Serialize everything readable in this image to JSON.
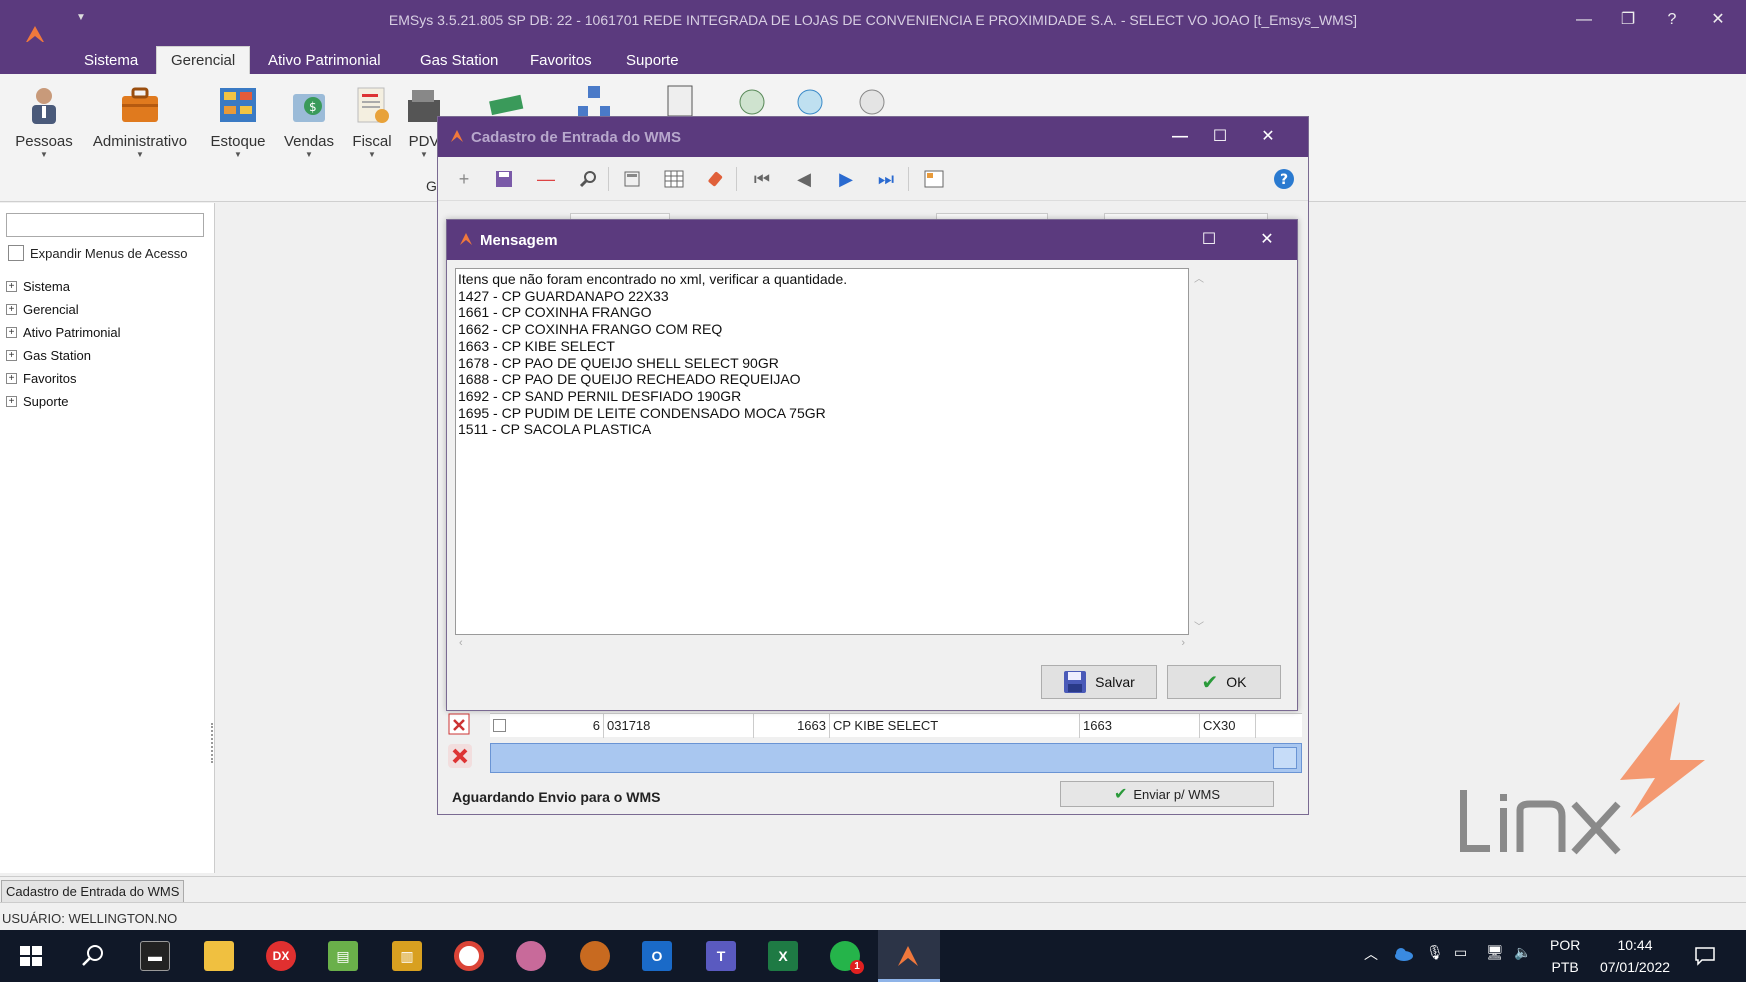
{
  "app": {
    "title": "EMSys 3.5.21.805 SP DB: 22 - 1061701 REDE INTEGRADA DE LOJAS DE CONVENIENCIA E PROXIMIDADE S.A. - SELECT VO JOAO [t_Emsys_WMS]",
    "minimize": "—",
    "restore": "❐",
    "help": "?",
    "close": "✕"
  },
  "menu": {
    "tabs": [
      {
        "label": "Sistema"
      },
      {
        "label": "Gerencial"
      },
      {
        "label": "Ativo Patrimonial"
      },
      {
        "label": "Gas Station"
      },
      {
        "label": "Favoritos"
      },
      {
        "label": "Suporte"
      }
    ]
  },
  "ribbon": {
    "items": [
      {
        "label": "Pessoas",
        "icon": "people-icon"
      },
      {
        "label": "Administrativo",
        "icon": "briefcase-icon"
      },
      {
        "label": "Estoque",
        "icon": "inventory-icon"
      },
      {
        "label": "Vendas",
        "icon": "sales-icon"
      },
      {
        "label": "Fiscal",
        "icon": "fiscal-icon"
      },
      {
        "label": "PDV",
        "icon": "pos-icon"
      }
    ],
    "group_label": "G"
  },
  "leftpanel": {
    "expand_label": "Expandir Menus de Acesso",
    "tree": [
      {
        "label": "Sistema"
      },
      {
        "label": "Gerencial"
      },
      {
        "label": "Ativo Patrimonial"
      },
      {
        "label": "Gas Station"
      },
      {
        "label": "Favoritos"
      },
      {
        "label": "Suporte"
      }
    ]
  },
  "wms_window": {
    "title": "Cadastro de Entrada do WMS",
    "grid_row": {
      "seq": "6",
      "code": "031718",
      "item": "1663",
      "description": "CP KIBE SELECT",
      "ref": "1663",
      "unit": "CX30"
    },
    "footer_status": "Aguardando Envio para o WMS",
    "send_button": "Enviar p/ WMS"
  },
  "message_dialog": {
    "title": "Mensagem",
    "lines": [
      "Itens que não foram encontrado no xml, verificar a quantidade.",
      "1427 - CP GUARDANAPO 22X33",
      "1661 - CP COXINHA FRANGO",
      "1662 - CP COXINHA FRANGO COM REQ",
      "1663 - CP KIBE SELECT",
      "1678 - CP PAO DE QUEIJO SHELL SELECT 90GR",
      "1688 - CP PAO DE QUEIJO RECHEADO REQUEIJAO",
      "1692 - CP SAND PERNIL DESFIADO 190GR",
      "1695 - CP PUDIM DE LEITE CONDENSADO MOCA 75GR",
      "1511 - CP SACOLA PLASTICA"
    ],
    "save_button": "Salvar",
    "ok_button": "OK"
  },
  "open_form_tab": "Cadastro de Entrada do WMS",
  "status": {
    "user": "USUÁRIO: WELLINGTON.NO"
  },
  "taskbar": {
    "lang_top": "POR",
    "lang_bottom": "PTB",
    "time": "10:44",
    "date": "07/01/2022",
    "whatsapp_badge": "1"
  },
  "colors": {
    "titlebar": "#5b3a7e",
    "accent": "#f0783c"
  }
}
